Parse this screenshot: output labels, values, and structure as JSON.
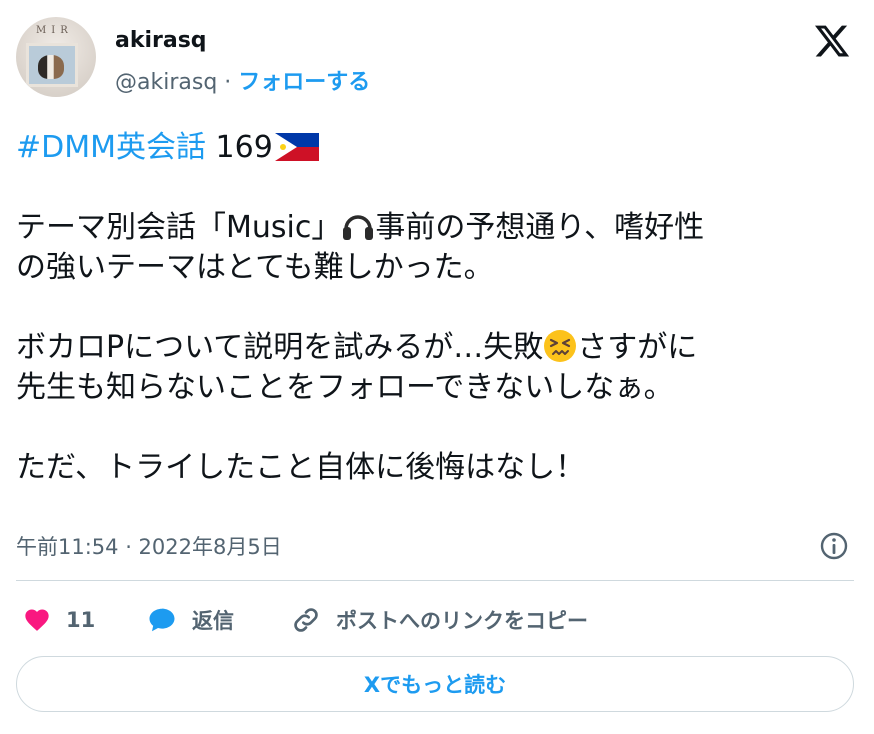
{
  "author": {
    "username": "akirasq",
    "handle": "@akirasq",
    "separator": " · ",
    "follow_label": "フォローする"
  },
  "tweet": {
    "hashtag": "#DMM英会話",
    "number": " 169",
    "line2a": "テーマ別会話「Music」",
    "line2b": "事前の予想通り、嗜好性",
    "line3": "の強いテーマはとても難しかった。",
    "line4a": "ボカロPについて説明を試みるが…失敗",
    "line4b": "さすがに",
    "line5": "先生も知らないことをフォローできないしなぁ。",
    "line6": "ただ、トライしたこと自体に後悔はなし！"
  },
  "timestamp": "午前11:54 · 2022年8月5日",
  "actions": {
    "like_count": "11",
    "reply_label": "返信",
    "copy_link_label": "ポストへのリンクをコピー"
  },
  "read_more_label": "Xでもっと読む",
  "icons": {
    "flag": "philippines-flag-icon",
    "headphones": "headphone-icon",
    "emoji": "persevering-face-icon",
    "like": "heart-icon",
    "reply": "reply-bubble-icon",
    "link": "link-icon",
    "info": "info-icon",
    "logo": "x-logo-icon"
  },
  "colors": {
    "accent": "#1d9bf0",
    "like": "#f91880",
    "text": "#0f1419",
    "secondary": "#536471",
    "border": "#cfd9de"
  }
}
